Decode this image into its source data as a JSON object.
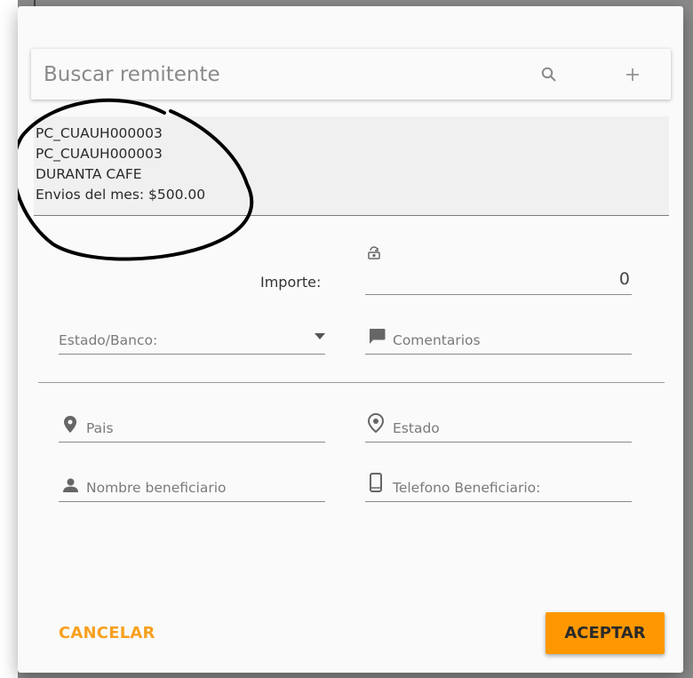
{
  "search": {
    "placeholder": "Buscar remitente",
    "search_icon": "search-icon",
    "add_icon": "plus-icon"
  },
  "sender": {
    "lines": [
      "PC_CUAUH000003",
      "PC_CUAUH000003",
      "DURANTA CAFE",
      "Envios del mes: $500.00"
    ]
  },
  "form": {
    "importe_label": "Importe:",
    "importe_value": "0",
    "importe_icon": "cash-exchange-icon",
    "estado_banco": "Estado/Banco:",
    "comentarios": "Comentarios",
    "pais": "Pais",
    "estado": "Estado",
    "nombre_beneficiario": "Nombre beneficiario",
    "telefono_beneficiario": "Telefono Beneficiario:"
  },
  "actions": {
    "cancel": "CANCELAR",
    "accept": "ACEPTAR"
  },
  "colors": {
    "accent": "#ff9800",
    "cancel_text": "#f7a020"
  }
}
